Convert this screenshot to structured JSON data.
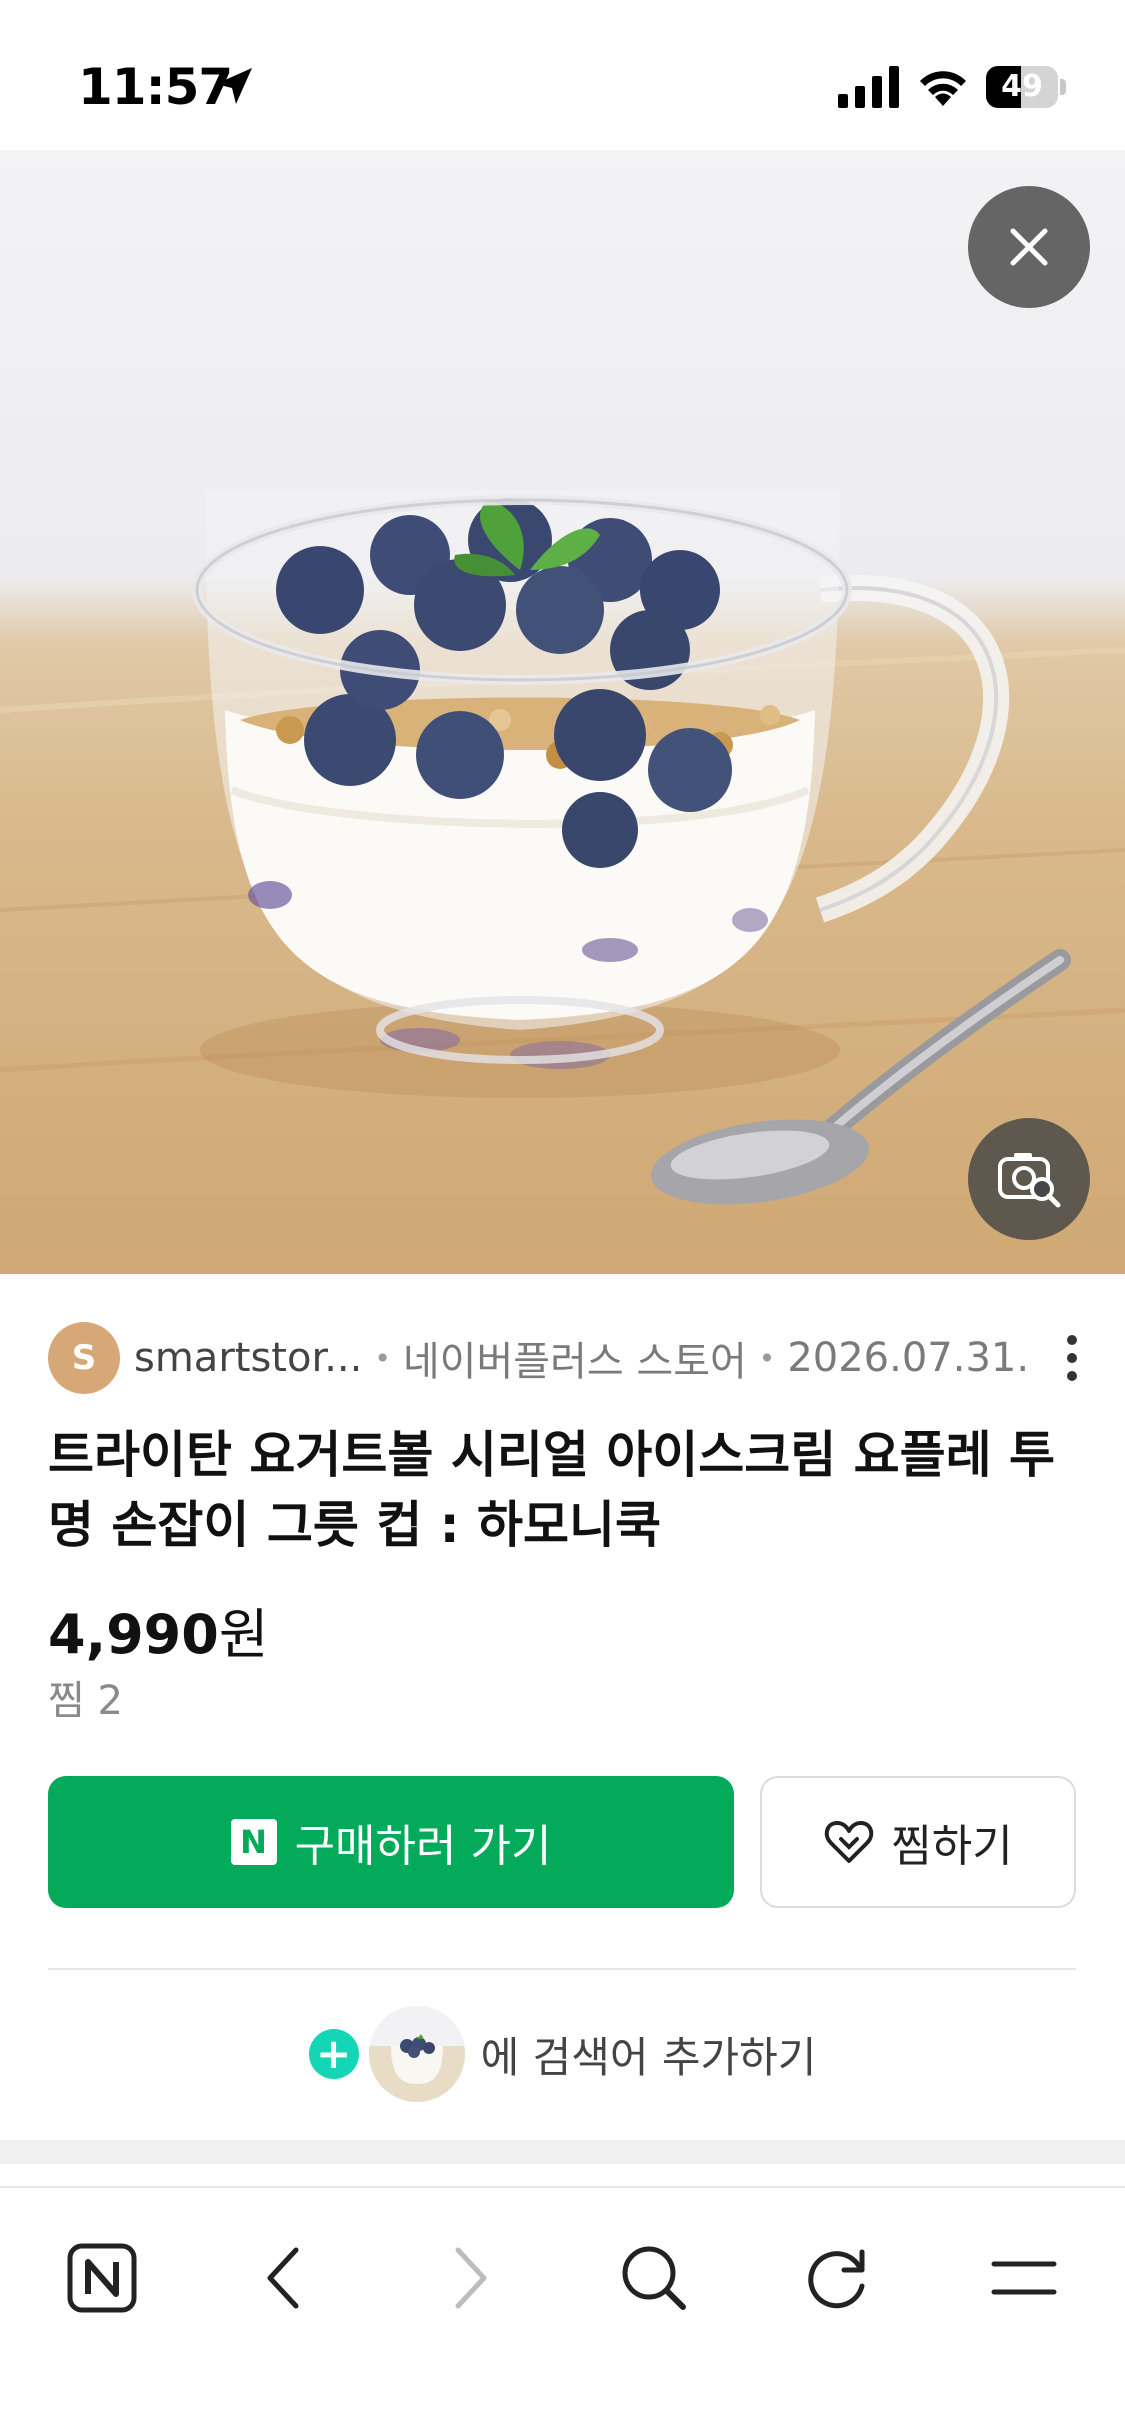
{
  "status_bar": {
    "time": "11:57",
    "battery_level": "49",
    "icons": [
      "location-arrow-icon",
      "cellular-signal-icon",
      "wifi-icon",
      "battery-icon"
    ]
  },
  "hero_image": {
    "subject": "yogurt cup with blueberries and granola",
    "close_icon": "close-icon",
    "lens_icon": "image-search-icon"
  },
  "product": {
    "seller_initial": "S",
    "seller": "smartstor...",
    "store_type": "네이버플러스 스토어",
    "date": "2026.07.31.",
    "title": "트라이탄 요거트볼 시리얼 아이스크림 요플레 투명 손잡이 그릇 컵 : 하모니쿡",
    "price_number": "4,990",
    "price_unit": "원",
    "zzim_count": "찜 2"
  },
  "actions": {
    "buy_badge": "N",
    "buy_label": "구매하러 가기",
    "wish_label": "찜하기",
    "add_search_label": "에 검색어 추가하기"
  },
  "toolbar": {
    "items": [
      "naver-home-icon",
      "back-icon",
      "forward-icon",
      "search-icon",
      "reload-icon",
      "menu-icon"
    ]
  },
  "colors": {
    "buy_green": "#03aa5a",
    "plus_teal": "#14d6b6",
    "overlay_dark": "#464646"
  }
}
